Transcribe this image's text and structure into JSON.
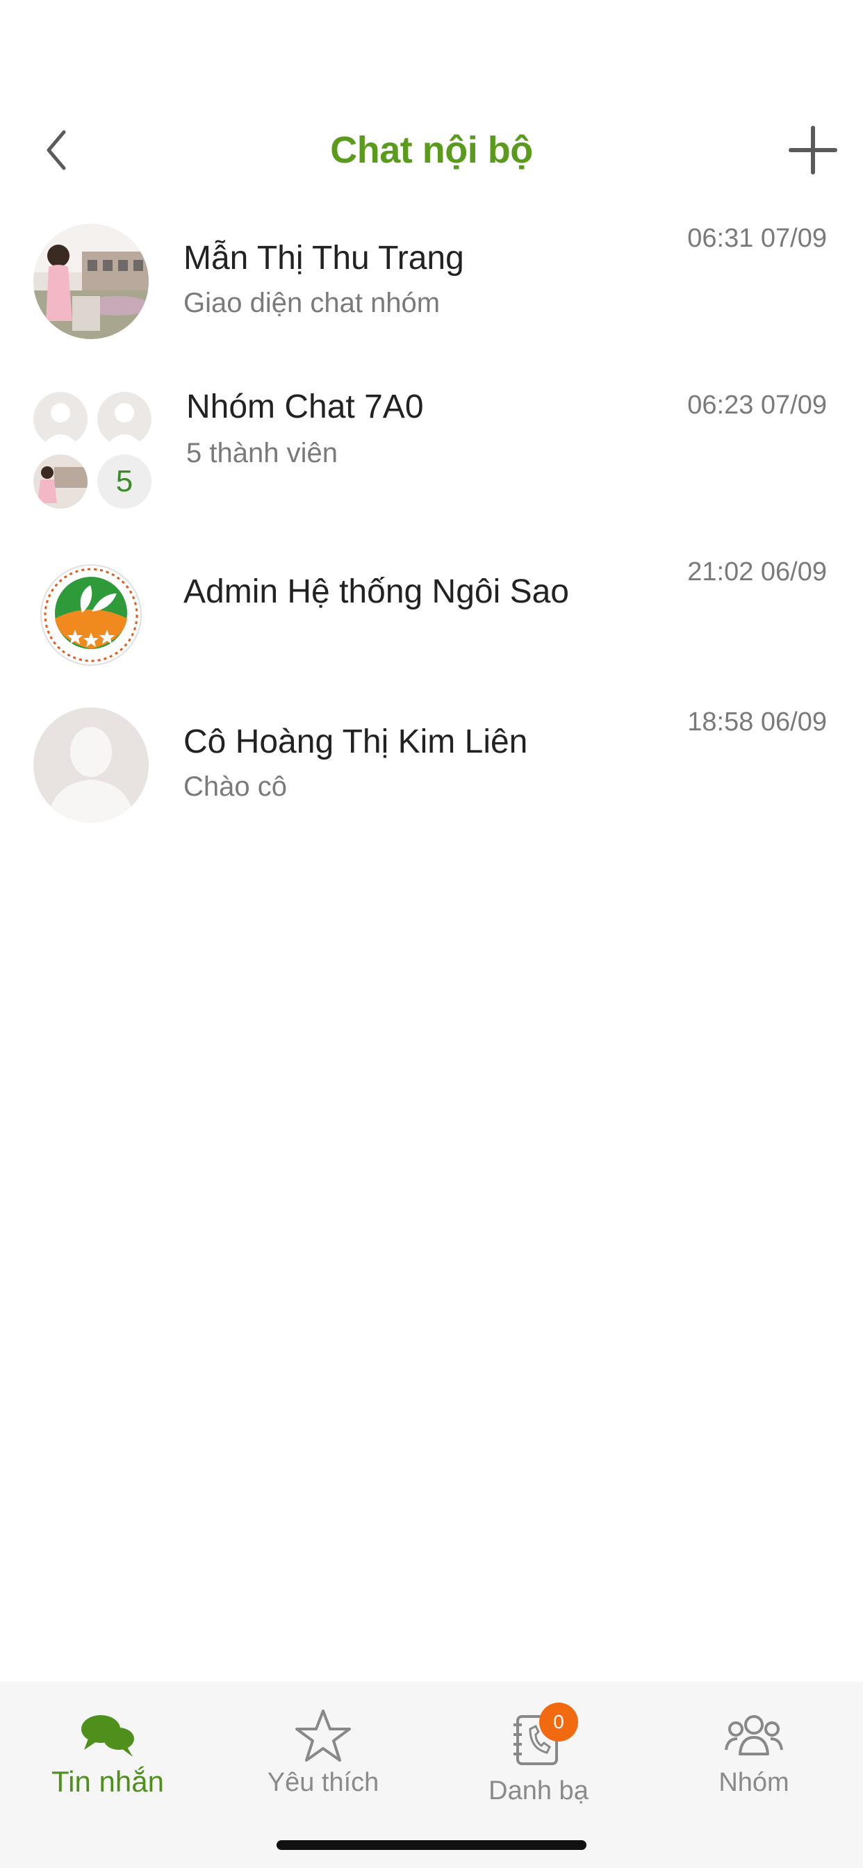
{
  "header": {
    "title": "Chat nội bộ",
    "back_icon": "chevron-left-icon",
    "add_icon": "plus-icon"
  },
  "chats": [
    {
      "name": "Mẫn Thị Thu Trang",
      "preview": "Giao diện chat nhóm",
      "time": "06:31 07/09",
      "avatar": "photo-avatar"
    },
    {
      "name": "Nhóm Chat 7A0",
      "preview": "5 thành viên",
      "time": "06:23 07/09",
      "avatar": "group-avatar",
      "member_count": "5"
    },
    {
      "name": "Admin Hệ thống Ngôi Sao",
      "preview": "",
      "time": "21:02 06/09",
      "avatar": "school-logo"
    },
    {
      "name": "Cô Hoàng Thị Kim Liên",
      "preview": "Chào cô",
      "time": "18:58 06/09",
      "avatar": "default-person-avatar"
    }
  ],
  "tabs": [
    {
      "label": "Tin nhắn",
      "icon": "chat-bubbles-icon",
      "active": true
    },
    {
      "label": "Yêu thích",
      "icon": "star-icon",
      "active": false
    },
    {
      "label": "Danh bạ",
      "icon": "contacts-book-icon",
      "active": false,
      "badge": "0"
    },
    {
      "label": "Nhóm",
      "icon": "group-people-icon",
      "active": false
    }
  ],
  "colors": {
    "accent": "#5a9a1d",
    "badge": "#f26a10",
    "inactive": "#8a8a8a"
  }
}
